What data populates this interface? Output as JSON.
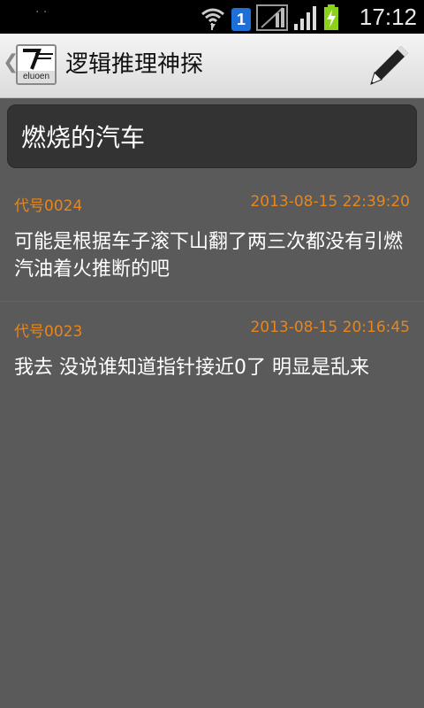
{
  "status_bar": {
    "left_indicator": "· ·",
    "sim_slot": "1",
    "time": "17:12"
  },
  "header": {
    "back_glyph": "❮",
    "logo_text": "eluoen",
    "title": "逻辑推理神探",
    "edit_icon": "pen-icon"
  },
  "topic": {
    "title": "燃烧的汽车"
  },
  "comments": [
    {
      "user": "代号0024",
      "time": "2013-08-15 22:39:20",
      "text": "可能是根据车子滚下山翻了两三次都没有引燃汽油着火推断的吧"
    },
    {
      "user": "代号0023",
      "time": "2013-08-15 20:16:45",
      "text": "我去 没说谁知道指针接近0了 明显是乱来"
    }
  ],
  "colors": {
    "accent": "#e8861a",
    "background": "#5a5a5a",
    "card": "#333333"
  }
}
